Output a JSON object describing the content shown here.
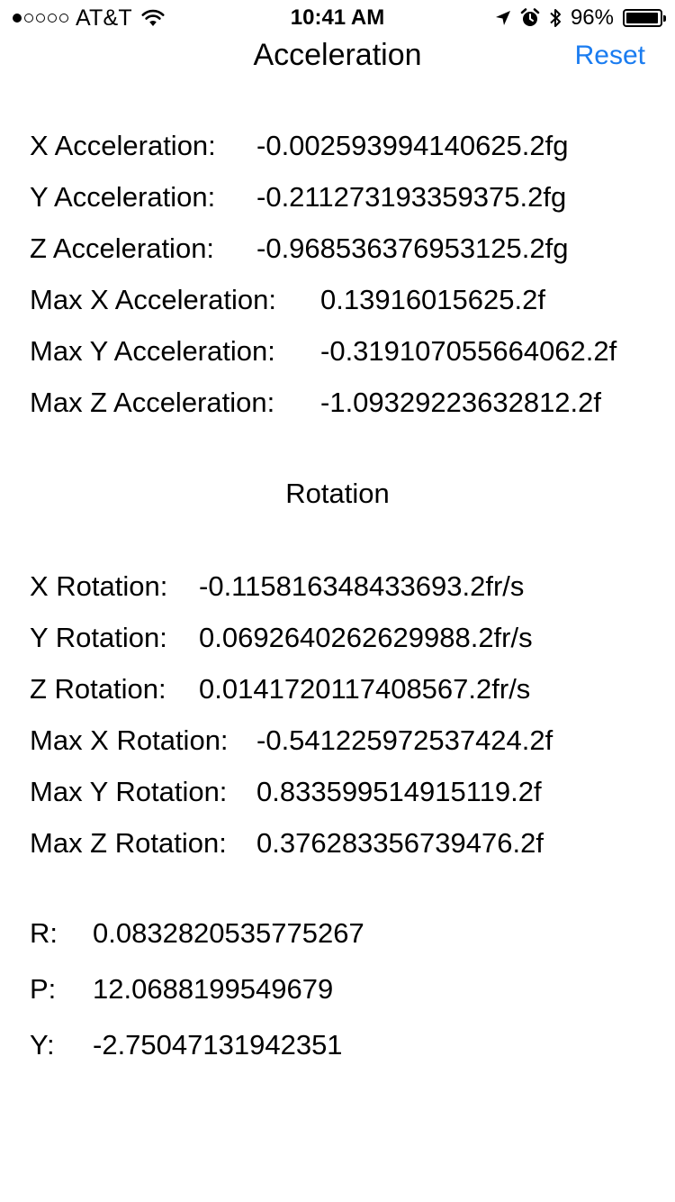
{
  "status_bar": {
    "signal_dots": [
      true,
      false,
      false,
      false,
      false
    ],
    "carrier": "AT&T",
    "time": "10:41 AM",
    "battery_percent_text": "96%",
    "battery_level": 0.96
  },
  "nav": {
    "title": "Acceleration",
    "reset_label": "Reset"
  },
  "acceleration": [
    {
      "label": "X Acceleration:",
      "value": "-0.002593994140625.2fg"
    },
    {
      "label": "Y Acceleration:",
      "value": "-0.211273193359375.2fg"
    },
    {
      "label": "Z Acceleration:",
      "value": "-0.968536376953125.2fg"
    },
    {
      "label": "Max X Acceleration:",
      "value": "0.13916015625.2f"
    },
    {
      "label": "Max Y Acceleration:",
      "value": "-0.319107055664062.2f"
    },
    {
      "label": "Max Z Acceleration:",
      "value": "-1.09329223632812.2f"
    }
  ],
  "rotation_title": "Rotation",
  "rotation": [
    {
      "label": "X Rotation:",
      "value": "-0.115816348433693.2fr/s"
    },
    {
      "label": "Y Rotation:",
      "value": "0.0692640262629988.2fr/s"
    },
    {
      "label": "Z Rotation:",
      "value": "0.0141720117408567.2fr/s"
    },
    {
      "label": "Max X Rotation:",
      "value": "-0.541225972537424.2f"
    },
    {
      "label": "Max Y Rotation:",
      "value": "0.833599514915119.2f"
    },
    {
      "label": "Max Z Rotation:",
      "value": "0.376283356739476.2f"
    }
  ],
  "attitude": [
    {
      "label": "R:",
      "value": "0.0832820535775267"
    },
    {
      "label": "P:",
      "value": "12.0688199549679"
    },
    {
      "label": "Y:",
      "value": "-2.75047131942351"
    }
  ],
  "colors": {
    "accent": "#1a7cf0",
    "text": "#000000",
    "background": "#ffffff"
  }
}
